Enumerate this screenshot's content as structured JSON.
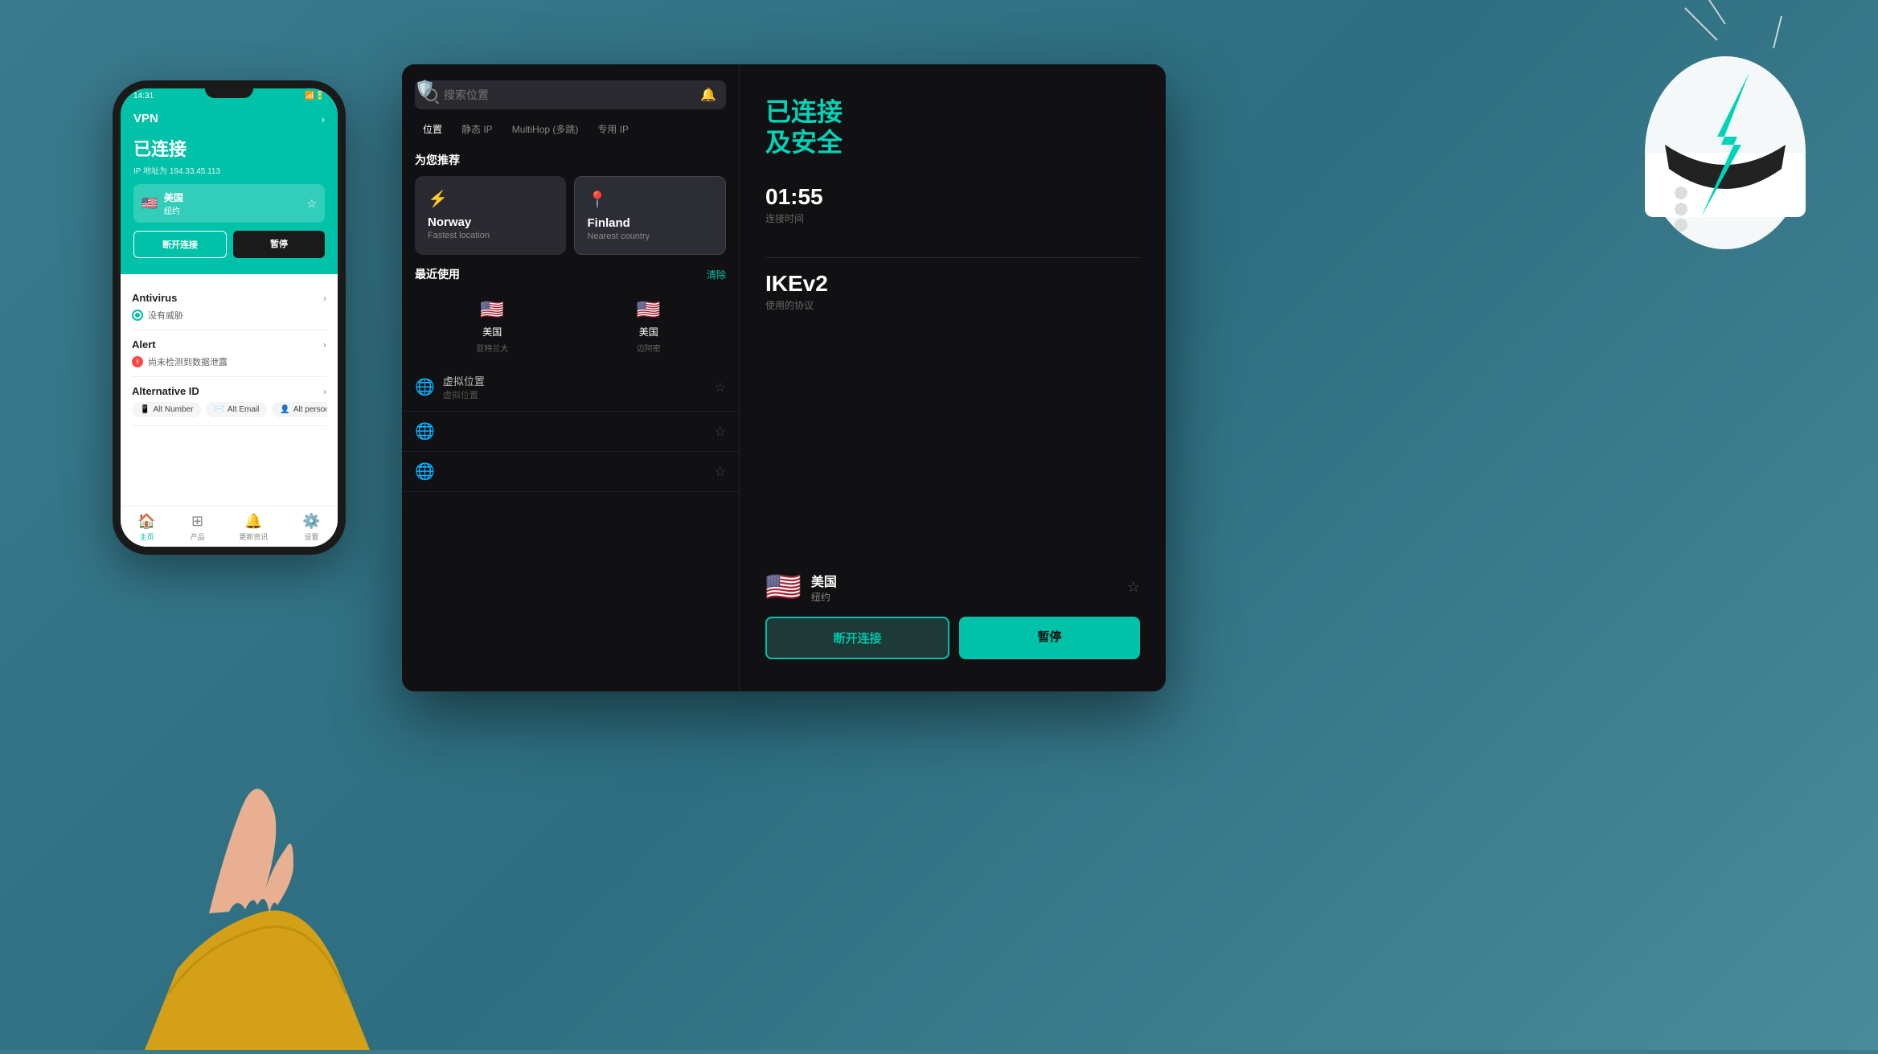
{
  "background": {
    "color": "#3d7a8a"
  },
  "desktop": {
    "search_placeholder": "搜索位置",
    "tabs": [
      {
        "label": "位置",
        "active": true
      },
      {
        "label": "静态 IP",
        "active": false
      },
      {
        "label": "MultiHop (多跳)",
        "active": false
      },
      {
        "label": "专用 IP",
        "active": false
      }
    ],
    "recommended_section_title": "为您推荐",
    "recommended_cards": [
      {
        "icon": "⚡",
        "country": "Norway",
        "label": "Fastest location"
      },
      {
        "icon": "📍",
        "country": "Finland",
        "label": "Nearest country"
      }
    ],
    "recently_used_title": "最近使用",
    "clear_label": "清除",
    "recently_used": [
      {
        "flag": "🇺🇸",
        "country": "美国",
        "city": "亚特兰大"
      },
      {
        "flag": "🇺🇸",
        "country": "美国",
        "city": "迈阿密"
      }
    ],
    "virtual_locations": [
      {
        "flag": "🏳️",
        "country": "虚拟位置",
        "city": "虚拟位置"
      },
      {
        "flag": "🏳️",
        "country": "",
        "city": ""
      },
      {
        "flag": "🏳️",
        "country": "",
        "city": ""
      }
    ],
    "right_panel": {
      "connected_title": "已连接\n及安全",
      "connection_time_label": "连接时间",
      "connection_time_value": "01:55",
      "protocol_label": "使用的协议",
      "protocol_value": "IKEv2",
      "connected_location_flag": "🇺🇸",
      "connected_location_country": "美国",
      "connected_location_city": "纽约",
      "disconnect_label": "断开连接",
      "pause_label": "暂停"
    }
  },
  "phone": {
    "status_bar_time": "14:31",
    "header_title": "VPN",
    "connected_title": "已连接",
    "ip_text": "IP 地址为 194.33.45.113",
    "location_country": "美国",
    "location_city": "纽约",
    "disconnect_btn": "断开连接",
    "pause_btn": "暂停",
    "antivirus_title": "Antivirus",
    "antivirus_status": "没有威胁",
    "alert_title": "Alert",
    "alert_status": "尚未检测到数据泄露",
    "alt_id_title": "Alternative ID",
    "alt_number": "Alt Number",
    "alt_email": "Alt Email",
    "alt_person": "Alt person",
    "nav_home": "主页",
    "nav_products": "产品",
    "nav_news": "更新资讯",
    "nav_settings": "设置"
  },
  "helmet": {
    "bolt_color": "#00d4b8"
  }
}
